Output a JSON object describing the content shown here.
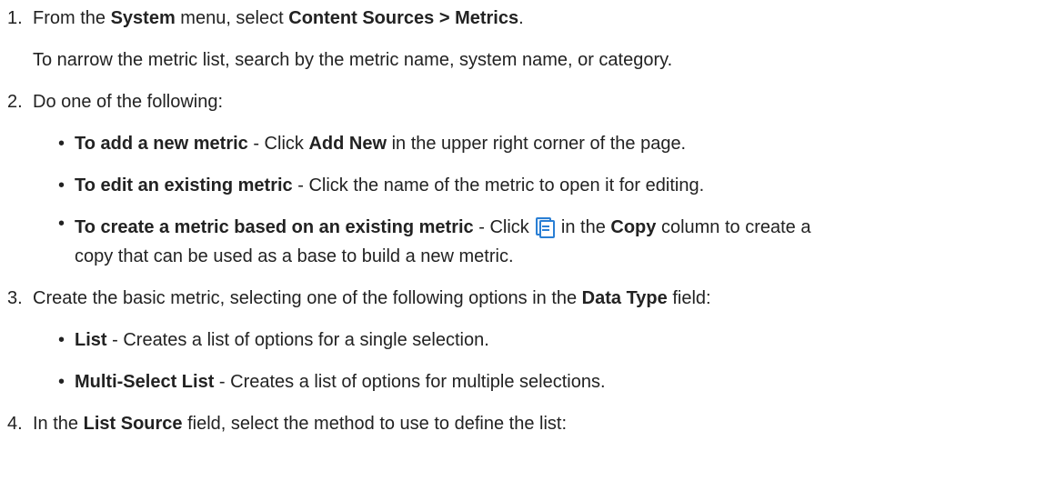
{
  "steps": [
    {
      "number": "1.",
      "parts": [
        "From the ",
        "System",
        " menu, select ",
        "Content Sources > Metrics",
        "."
      ],
      "note": "To narrow the metric list, search by the metric name, system name, or category."
    },
    {
      "number": "2.",
      "text": "Do one of the following:",
      "bullets": [
        {
          "bold": "To add a new metric",
          "pre": " - Click ",
          "bold2": "Add New",
          "post": " in the upper right corner of the page."
        },
        {
          "bold": "To edit an existing metric",
          "rest": " - Click the name of the metric to open it for editing."
        },
        {
          "bold": "To create a metric based on an existing metric",
          "pre": " - Click ",
          "icon": "copy-icon",
          "mid": " in the ",
          "bold2": "Copy",
          "post": " column to create a",
          "wrap": "copy that can be used as a base to build a new metric."
        }
      ]
    },
    {
      "number": "3.",
      "pre": "Create the basic metric, selecting one of the following options in the ",
      "bold": "Data Type",
      "post": " field:",
      "bullets": [
        {
          "bold": "List",
          "rest": " - Creates a list of options for a single selection."
        },
        {
          "bold": "Multi-Select List",
          "rest": " - Creates a list of options for multiple selections."
        }
      ]
    },
    {
      "number": "4.",
      "pre": "In the ",
      "bold": "List Source",
      "post": " field, select the method to use to define the list:"
    }
  ]
}
